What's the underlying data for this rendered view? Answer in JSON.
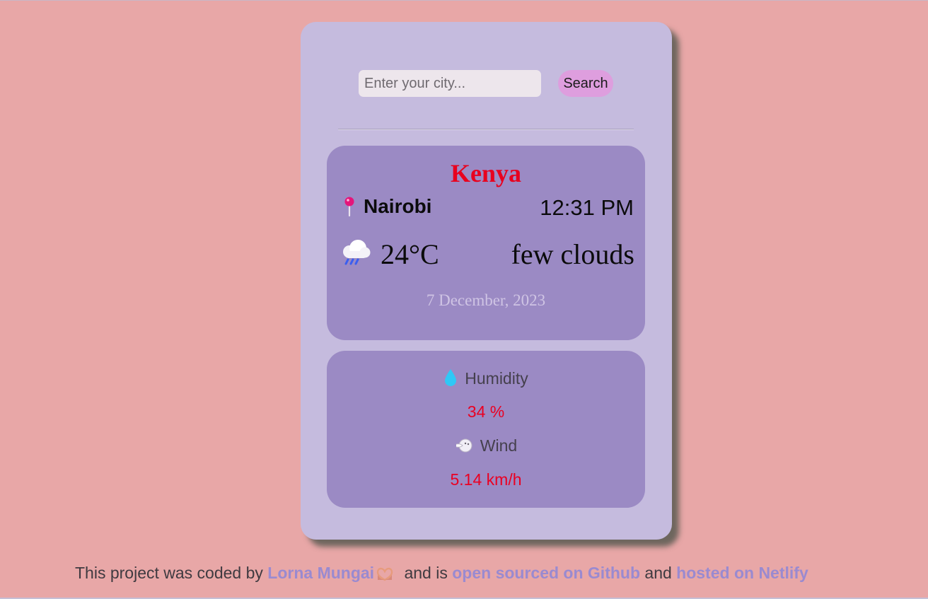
{
  "search": {
    "placeholder": "Enter your city...",
    "value": "",
    "button_label": "Search"
  },
  "weather": {
    "country": "Kenya",
    "city": "Nairobi",
    "time": "12:31 PM",
    "temperature": "24°C",
    "description": "few clouds",
    "date": "7 December, 2023",
    "icon": "rain-cloud-icon"
  },
  "details": {
    "humidity_label": "Humidity",
    "humidity_value": "34 %",
    "wind_label": "Wind",
    "wind_value": "5.14 km/h"
  },
  "footer": {
    "prefix": "This project was coded by",
    "author": "Lorna Mungai",
    "middle": "and is",
    "github_link": "open sourced on Github",
    "and": "and",
    "netlify_link": "hosted on Netlify"
  },
  "colors": {
    "background": "#e8a7a7",
    "card": "#c5bbde",
    "panel": "#9b8ac4",
    "accent_red": "#e8001e",
    "link": "#9a8ad0",
    "search_button": "#de9ede"
  }
}
